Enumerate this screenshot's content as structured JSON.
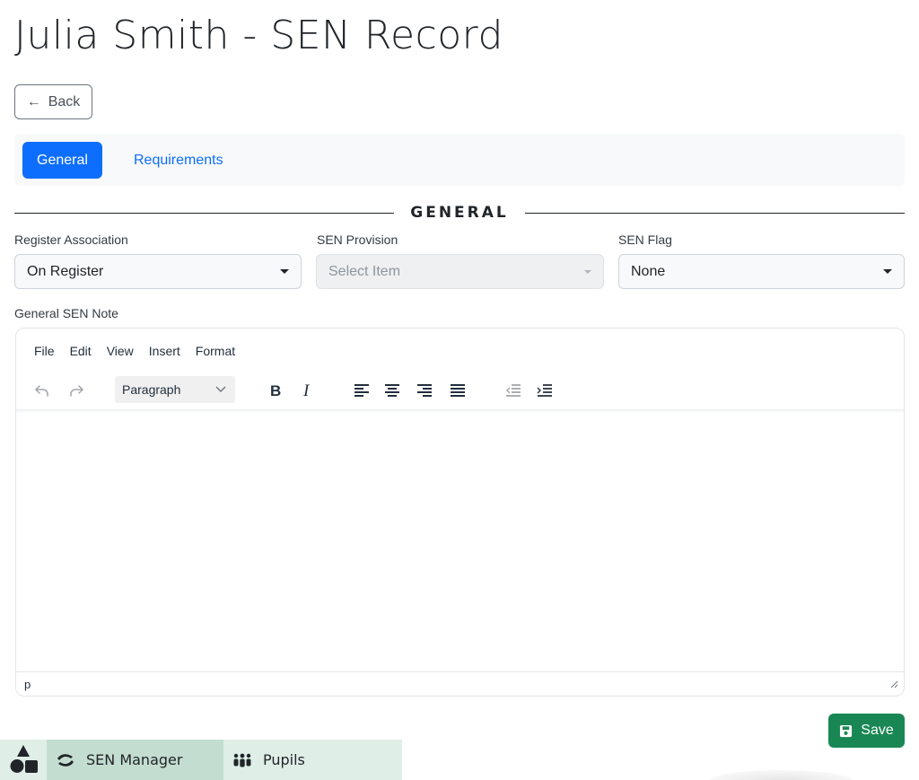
{
  "page": {
    "title": "Julia Smith - SEN Record"
  },
  "back_button": {
    "label": "Back",
    "icon": "arrow-left-icon"
  },
  "tabs": [
    {
      "label": "General",
      "active": true
    },
    {
      "label": "Requirements",
      "active": false
    }
  ],
  "section": {
    "heading": "GENERAL"
  },
  "fields": {
    "register_association": {
      "label": "Register Association",
      "value": "On Register"
    },
    "sen_provision": {
      "label": "SEN Provision",
      "placeholder": "Select Item",
      "disabled": true
    },
    "sen_flag": {
      "label": "SEN Flag",
      "value": "None"
    }
  },
  "editor": {
    "label": "General SEN Note",
    "menu": [
      "File",
      "Edit",
      "View",
      "Insert",
      "Format"
    ],
    "block_format": "Paragraph",
    "toolbar_icons": [
      "undo-icon",
      "redo-icon",
      "bold-icon",
      "italic-icon",
      "align-left-icon",
      "align-center-icon",
      "align-right-icon",
      "align-justify-icon",
      "outdent-icon",
      "indent-icon"
    ],
    "statusbar_path": "p",
    "content": ""
  },
  "save_button": {
    "label": "Save",
    "icon": "save-icon",
    "color": "#198754"
  },
  "bottom_nav": {
    "logo_icon": "shapes-logo-icon",
    "items": [
      {
        "label": "SEN Manager",
        "icon": "hands-icon",
        "active": true
      },
      {
        "label": "Pupils",
        "icon": "people-group-icon",
        "active": false
      }
    ]
  },
  "colors": {
    "primary": "#0d6efd",
    "success": "#198754",
    "nav_bg": "#dfeee7",
    "nav_active": "#c4ddd1"
  }
}
